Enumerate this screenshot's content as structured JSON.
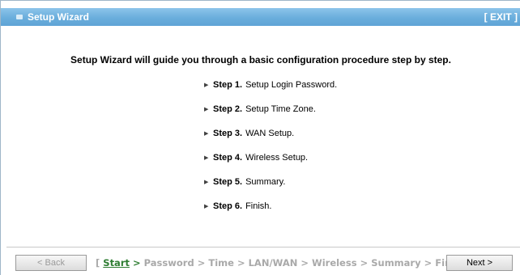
{
  "window": {
    "title": "Setup Wizard",
    "exit_label": "[ EXIT ]"
  },
  "main": {
    "heading": "Setup Wizard will guide you through a basic configuration procedure step by step.",
    "steps": [
      {
        "num": "Step 1.",
        "label": "Setup Login Password."
      },
      {
        "num": "Step 2.",
        "label": "Setup Time Zone."
      },
      {
        "num": "Step 3.",
        "label": "WAN Setup."
      },
      {
        "num": "Step 4.",
        "label": "Wireless Setup."
      },
      {
        "num": "Step 5.",
        "label": "Summary."
      },
      {
        "num": "Step 6.",
        "label": "Finish."
      }
    ]
  },
  "footer": {
    "back_label": "< Back",
    "next_label": "Next >",
    "breadcrumb": {
      "open": "[",
      "items": [
        "Start",
        "Password",
        "Time",
        "LAN/WAN",
        "Wireless",
        "Summary",
        "Finish!"
      ],
      "separator": ">",
      "close": "]",
      "active": "Start"
    }
  },
  "colors": {
    "titlebar": "#6aaedc",
    "active_step": "#2e7d32",
    "inactive_step": "#a9a9a9"
  },
  "icons": {
    "title_icon": "window-icon",
    "step_bullet": "triangle-right-icon"
  }
}
